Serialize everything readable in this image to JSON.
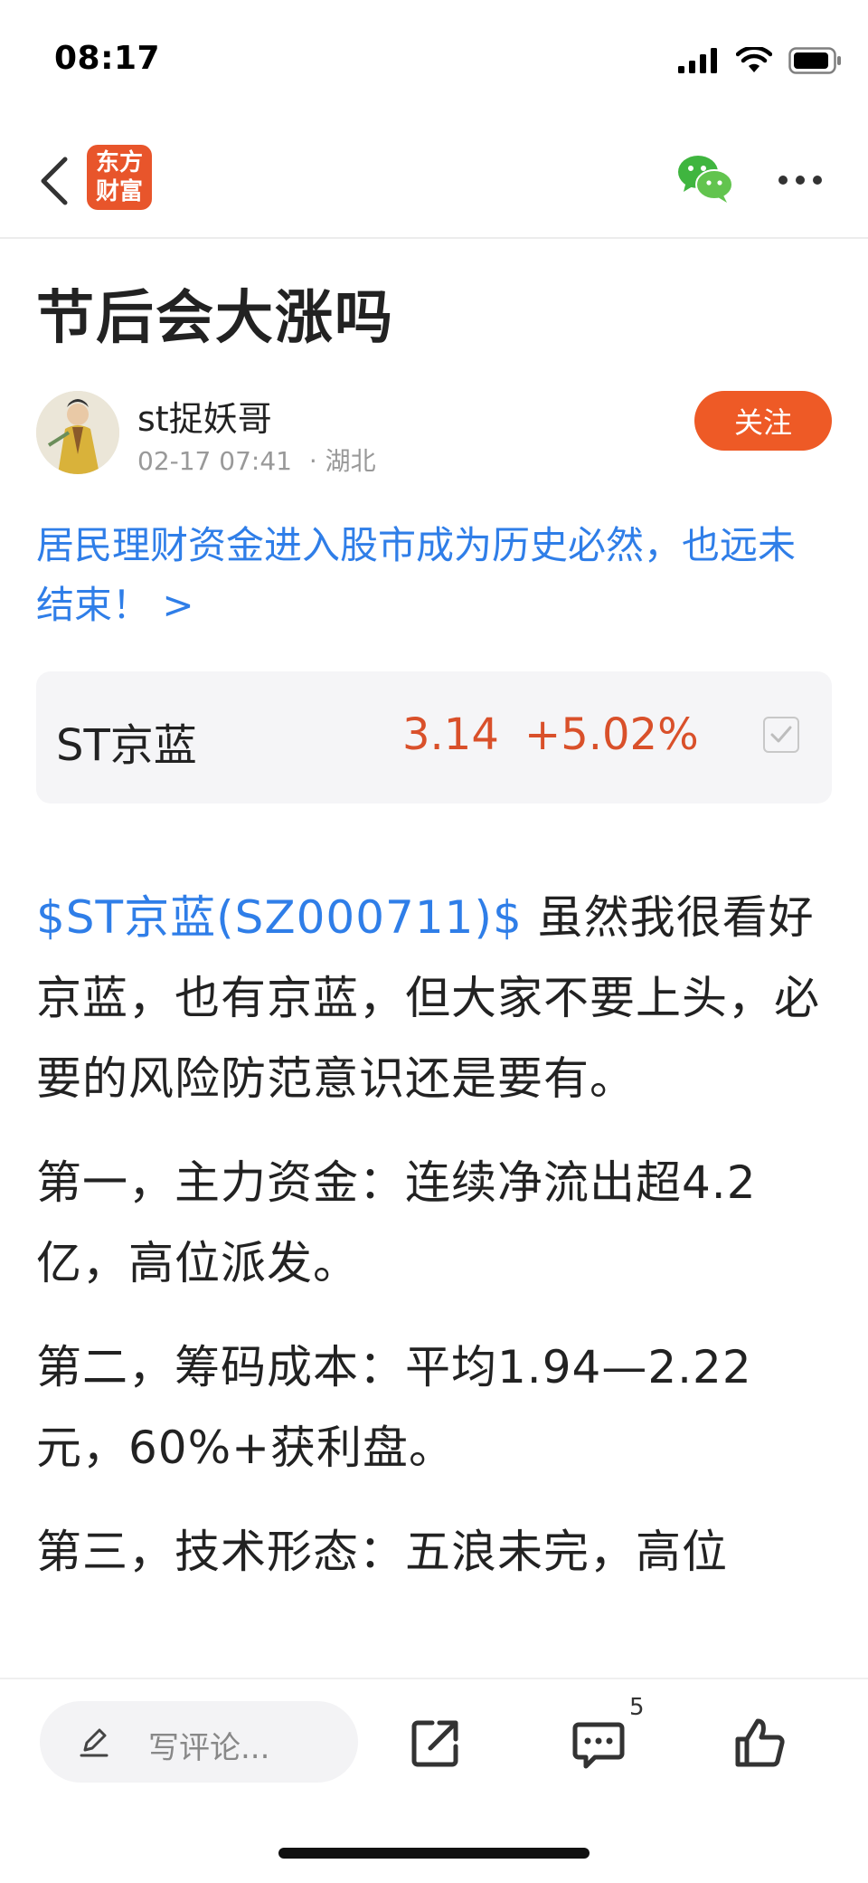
{
  "status": {
    "time": "08:17"
  },
  "nav": {
    "logo_line1": "东方",
    "logo_line2": "财富"
  },
  "article": {
    "title": "节后会大涨吗",
    "author": "st捉妖哥",
    "datetime": "02-17 07:41",
    "location": "· 湖北",
    "follow_label": "关注",
    "promo": "居民理财资金进入股市成为历史必然，也远未结束！ >"
  },
  "stock": {
    "name": "ST京蓝",
    "price": "3.14",
    "change": "+5.02%"
  },
  "body": {
    "ticker": "$ST京蓝(SZ000711)$",
    "p1_rest": " 虽然我很看好京蓝，也有京蓝，但大家不要上头，必要的风险防范意识还是要有。",
    "p2": "第一，主力资金：连续净流出超4.2亿，高位派发。",
    "p3": "第二，筹码成本：平均1.94—2.22元，60%+获利盘。",
    "p4": "第三，技术形态：五浪未完，高位"
  },
  "bottom": {
    "comment_placeholder": "写评论...",
    "comment_count": "5"
  },
  "colors": {
    "brand": "#e8552b",
    "link": "#2f7ee8",
    "up": "#d9502a",
    "follow": "#ee5a26"
  }
}
